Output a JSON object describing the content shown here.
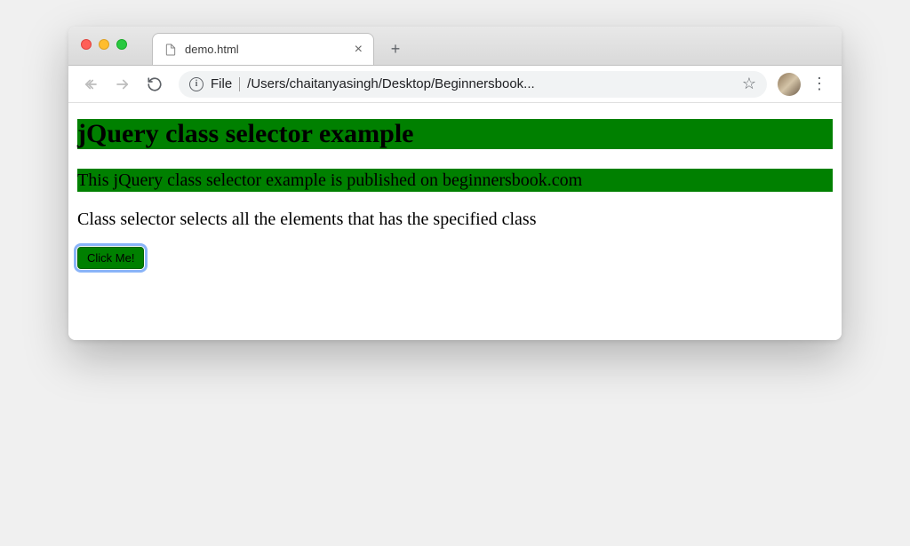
{
  "browser": {
    "tab": {
      "title": "demo.html"
    },
    "omnibox": {
      "scheme": "File",
      "path": "/Users/chaitanyasingh/Desktop/Beginnersbook..."
    }
  },
  "page": {
    "heading": "jQuery class selector example",
    "paragraph1": "This jQuery class selector example is published on beginnersbook.com",
    "paragraph2": "Class selector selects all the elements that has the specified class",
    "button_label": "Click Me!"
  },
  "colors": {
    "highlight": "#008000"
  }
}
